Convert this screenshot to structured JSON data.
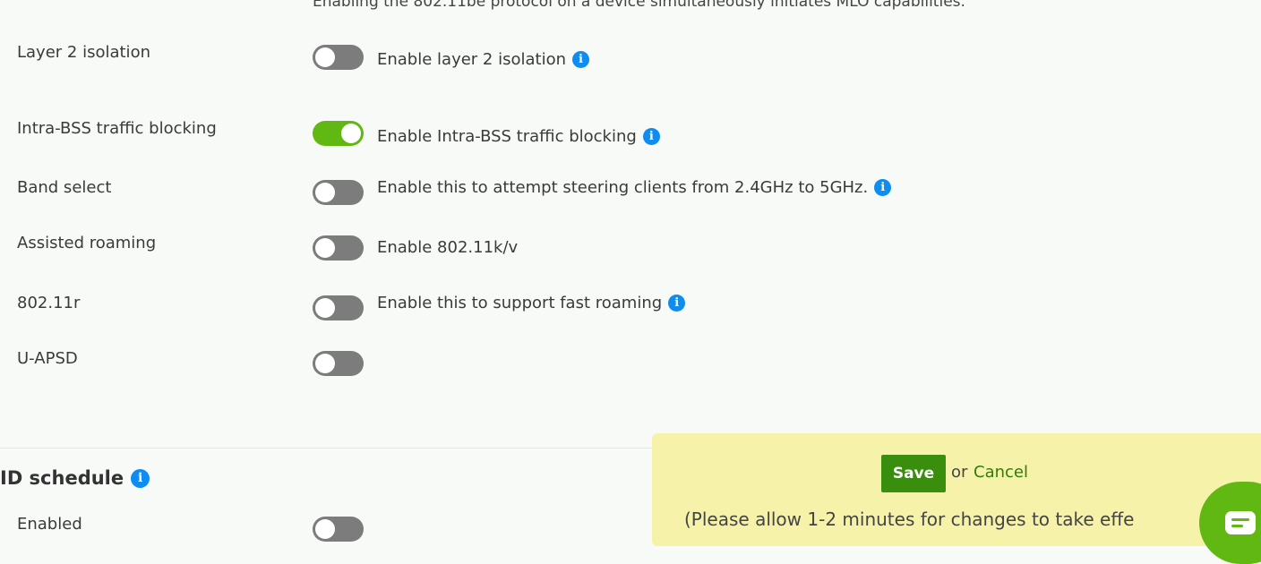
{
  "mlo_note": "Enabling the 802.11be protocol on a device simultaneously initiates MLO capabilities.",
  "rows": [
    {
      "label": "Layer 2 isolation",
      "enabled": false,
      "description": "Enable layer 2 isolation",
      "info": true
    },
    {
      "label": "Intra-BSS traffic blocking",
      "enabled": true,
      "description": "Enable Intra-BSS traffic blocking",
      "info": true
    },
    {
      "label": "Band select",
      "enabled": false,
      "description": "Enable this to attempt steering clients from 2.4GHz to 5GHz.",
      "info": true
    },
    {
      "label": "Assisted roaming",
      "enabled": false,
      "description": "Enable 802.11k/v",
      "info": false
    },
    {
      "label": "802.11r",
      "enabled": false,
      "description": "Enable this to support fast roaming",
      "info": true
    },
    {
      "label": "U-APSD",
      "enabled": false,
      "description": "",
      "info": false
    }
  ],
  "schedule": {
    "title": "ID schedule",
    "enabled_label": "Enabled",
    "enabled": false
  },
  "savebar": {
    "save_label": "Save",
    "or_text": "or",
    "cancel_label": "Cancel",
    "allow_text": "(Please allow 1-2 minutes for changes to take effe"
  },
  "icons": {
    "info": "info-icon",
    "chat": "chat-icon"
  },
  "colors": {
    "toggle_on": "#62b812",
    "toggle_off": "#7c7c7c",
    "info": "#0f8cf0",
    "save_button": "#3a8e0e",
    "cancel_link": "#2e7d0c",
    "savebar_bg": "#f6f2aa"
  }
}
